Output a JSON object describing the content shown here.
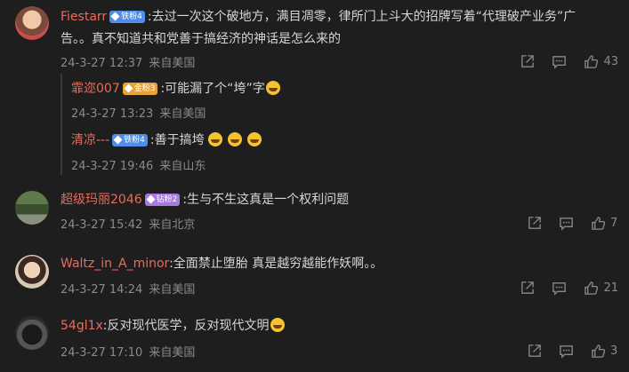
{
  "comments": [
    {
      "username": "Fiestarr",
      "badge": "铁粉4",
      "text_line1": ":去过一次这个破地方，满目凋零，律所门上斗大的招牌写着“代理破产业务”广",
      "text_line2": "告。。真不知道共和党善于搞经济的神话是怎么来的",
      "date": "24-3-27 12:37",
      "location": "来自美国",
      "likes": "43"
    },
    {
      "username": "超级玛丽2046",
      "badge": "钻粉2",
      "text": ":生与不生这真是一个权利问题",
      "date": "24-3-27 15:42",
      "location": "来自北京",
      "likes": "7"
    },
    {
      "username": "Waltz_in_A_minor",
      "text": ":全面禁止堕胎 真是越穷越能作妖啊。。",
      "date": "24-3-27 14:24",
      "location": "来自美国",
      "likes": "21"
    },
    {
      "username": "54gl1x",
      "text": ":反对现代医学，反对现代文明",
      "date": "24-3-27 17:10",
      "location": "来自美国",
      "likes": "3"
    }
  ],
  "replies": [
    {
      "username": "霏迩007",
      "badge": "金粉3",
      "text": ":可能漏了个“垮”字",
      "date": "24-3-27 13:23",
      "location": "来自美国"
    },
    {
      "username": "清凉---",
      "badge": "铁粉4",
      "text": ":善于搞垮",
      "date": "24-3-27 19:46",
      "location": "来自山东"
    }
  ],
  "colors": {
    "background": "#1e1e1e",
    "username": "#e86c5c",
    "meta": "#8a8a8a"
  },
  "icons": [
    "share-icon",
    "comment-icon",
    "like-icon",
    "laugh-emoji"
  ]
}
